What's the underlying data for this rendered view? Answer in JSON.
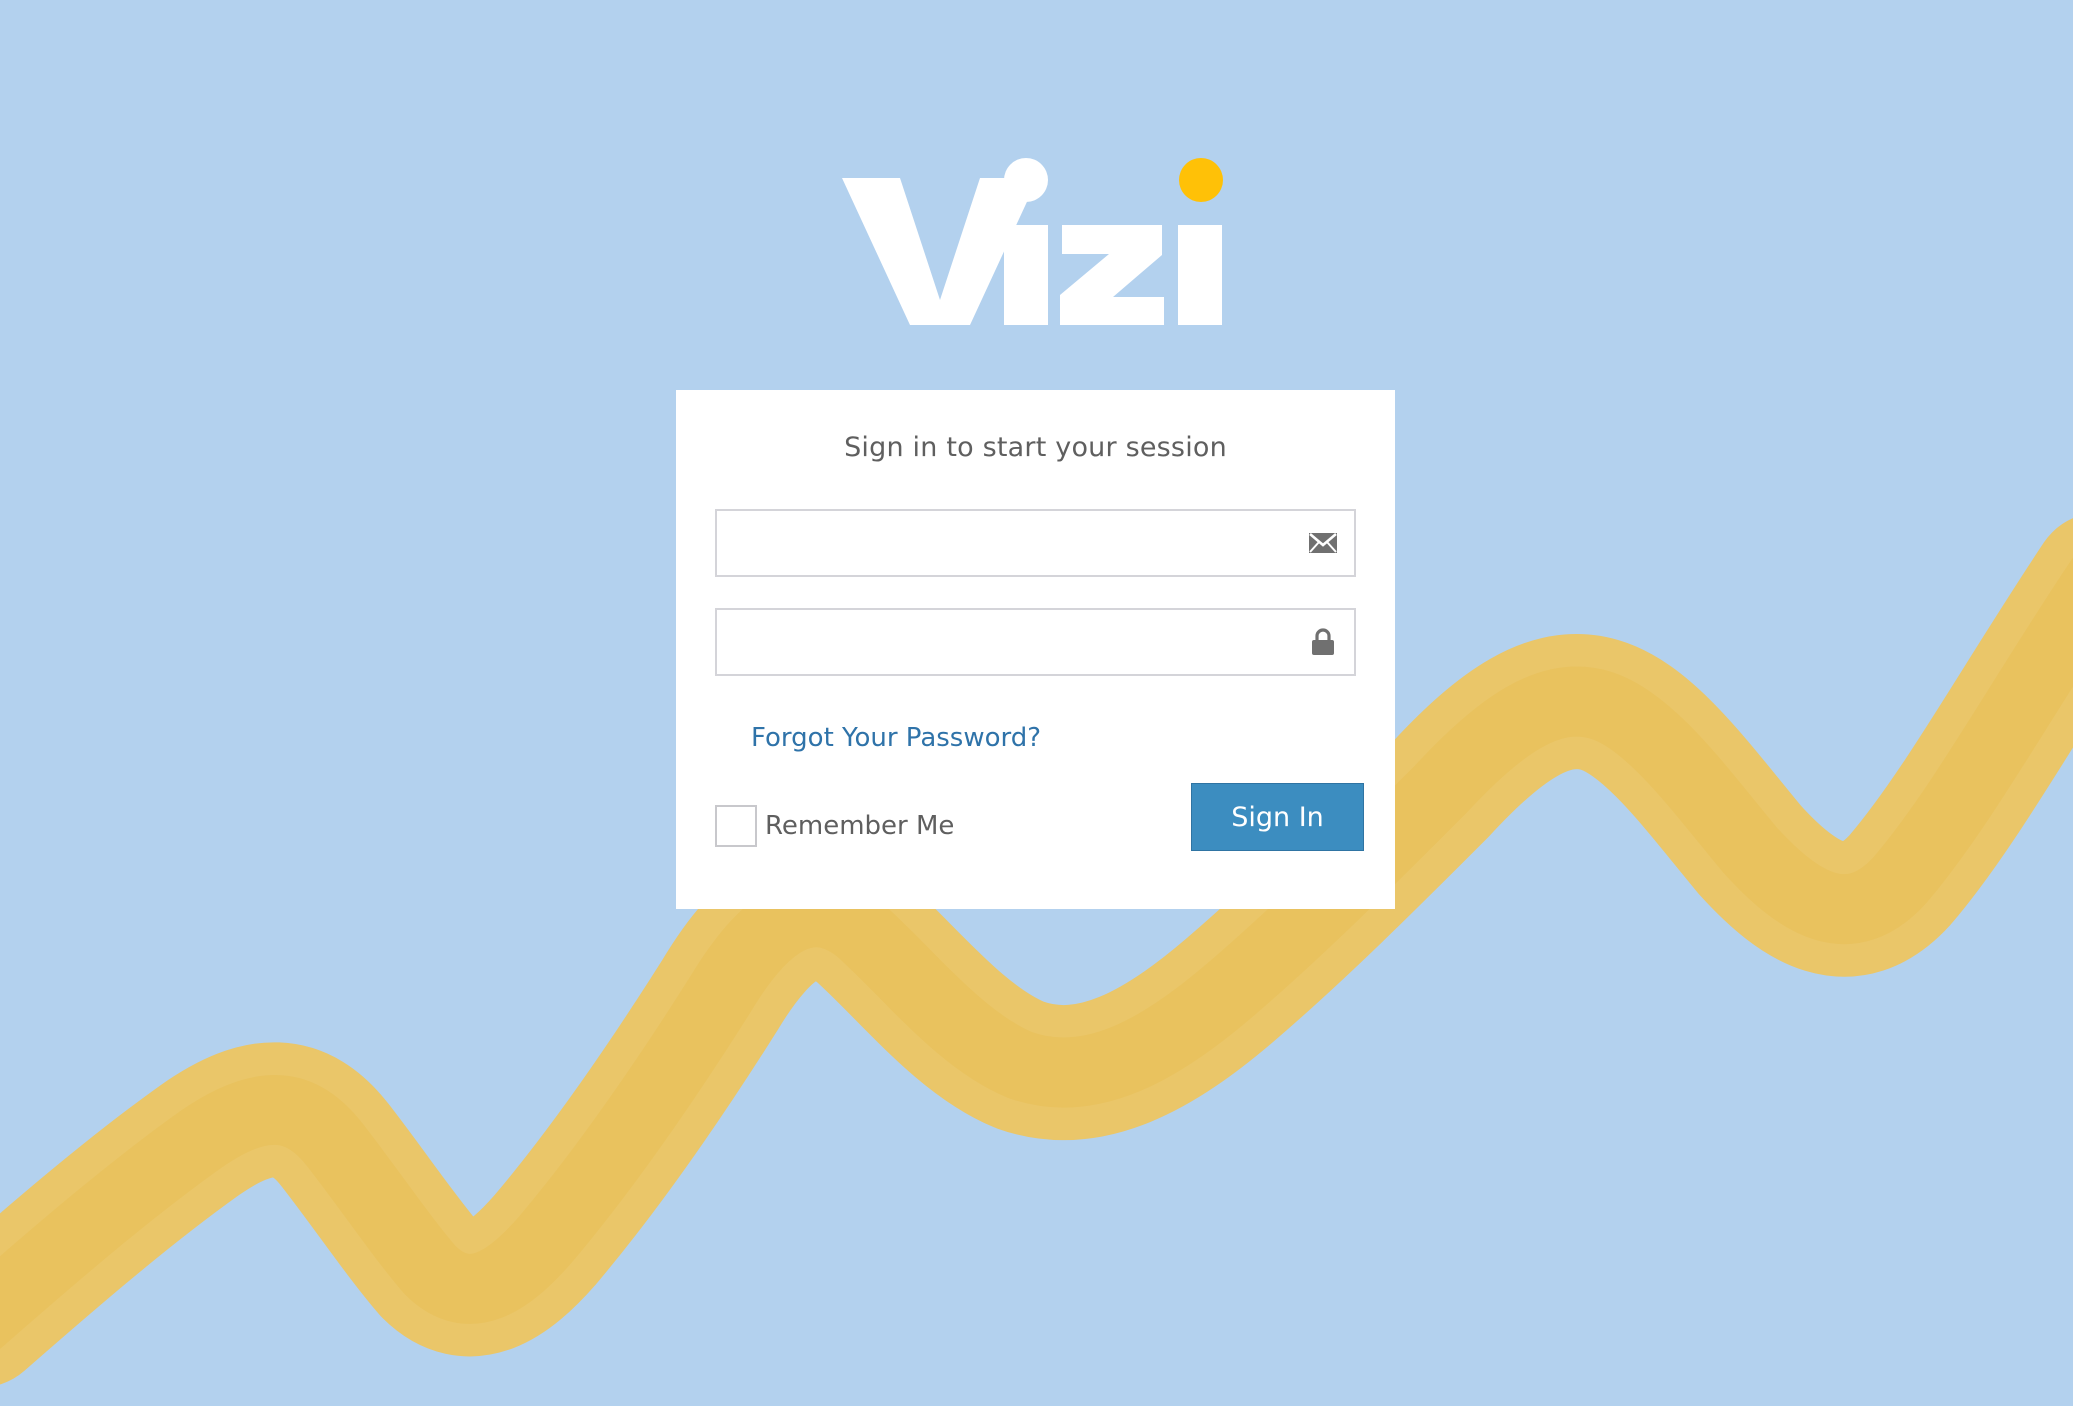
{
  "brand": {
    "name": "Vizi",
    "accent_color": "#ffc107",
    "background_color": "#b3d1ee",
    "wave_color": "#efc45a"
  },
  "login": {
    "title": "Sign in to start your session",
    "email": {
      "value": "",
      "placeholder": "",
      "icon": "envelope-icon"
    },
    "password": {
      "value": "",
      "placeholder": "",
      "icon": "lock-icon"
    },
    "forgot_password": "Forgot Your Password?",
    "remember_me": {
      "label": "Remember Me",
      "checked": false
    },
    "sign_in": "Sign In",
    "button_color": "#3c8dc0",
    "link_color": "#2f73a9"
  }
}
